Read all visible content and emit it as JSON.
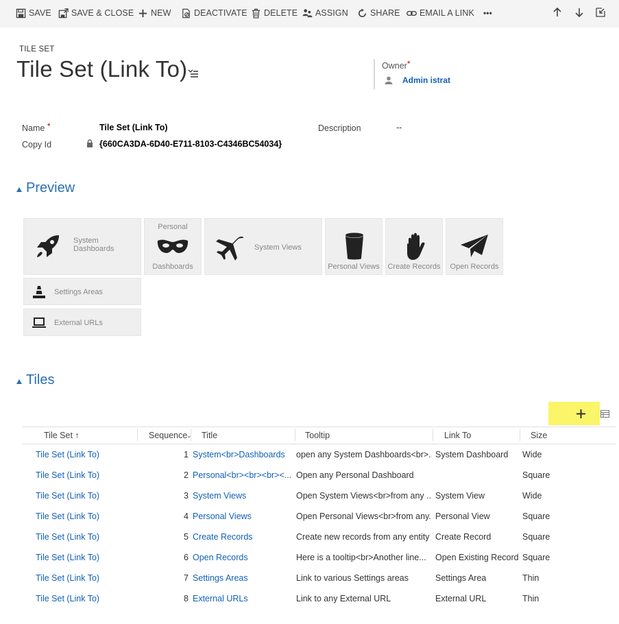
{
  "commandbar": {
    "save": "SAVE",
    "save_close": "SAVE & CLOSE",
    "new": "NEW",
    "deactivate": "DEACTIVATE",
    "delete": "DELETE",
    "assign": "ASSIGN",
    "share": "SHARE",
    "email_link": "EMAIL A LINK",
    "more": "•••"
  },
  "header": {
    "entity": "TILE SET",
    "title": "Tile Set (Link To)",
    "owner_label": "Owner",
    "owner_value": "Admin istrat",
    "required_mark": "*"
  },
  "fields": {
    "name_label": "Name",
    "name_value": "Tile Set (Link To)",
    "copyid_label": "Copy Id",
    "copyid_value": "{660CA3DA-6D40-E711-8103-C4346BC54034}",
    "description_label": "Description",
    "description_value": "--"
  },
  "preview": {
    "heading": "Preview",
    "tiles": {
      "system_dashboards": "System\nDashboards",
      "personal_top": "Personal",
      "personal_bottom": "Dashboards",
      "system_views": "System Views",
      "personal_views": "Personal Views",
      "create_records": "Create Records",
      "open_records": "Open Records",
      "settings_areas": "Settings Areas",
      "external_urls": "External URLs"
    }
  },
  "tiles_section": {
    "heading": "Tiles",
    "columns": [
      "Tile Set ↑",
      "Sequence",
      "Title",
      "Tooltip",
      "Link To",
      "Size"
    ],
    "rows": [
      {
        "tileset": "Tile Set (Link To)",
        "seq": "1",
        "title": "System<br>Dashboards",
        "tooltip": "open any System Dashboards<br>...",
        "linkto": "System Dashboard",
        "size": "Wide"
      },
      {
        "tileset": "Tile Set (Link To)",
        "seq": "2",
        "title": "Personal<br><br><br><...",
        "tooltip": "Open any Personal Dashboard",
        "linkto": "",
        "size": "Square"
      },
      {
        "tileset": "Tile Set (Link To)",
        "seq": "3",
        "title": "System Views",
        "tooltip": "Open System Views<br>from any ...",
        "linkto": "System View",
        "size": "Wide"
      },
      {
        "tileset": "Tile Set (Link To)",
        "seq": "4",
        "title": "Personal Views",
        "tooltip": "Open Personal Views<br>from any...",
        "linkto": "Personal View",
        "size": "Square"
      },
      {
        "tileset": "Tile Set (Link To)",
        "seq": "5",
        "title": "Create Records",
        "tooltip": "Create new records from any entity",
        "linkto": "Create Record",
        "size": "Square"
      },
      {
        "tileset": "Tile Set (Link To)",
        "seq": "6",
        "title": "Open Records",
        "tooltip": "Here is a tooltip<br>Another line...",
        "linkto": "Open Existing Record",
        "size": "Square"
      },
      {
        "tileset": "Tile Set (Link To)",
        "seq": "7",
        "title": "Settings Areas",
        "tooltip": "Link to various Settings areas",
        "linkto": "Settings Area",
        "size": "Thin"
      },
      {
        "tileset": "Tile Set (Link To)",
        "seq": "8",
        "title": "External URLs",
        "tooltip": "Link to any External URL",
        "linkto": "External URL",
        "size": "Thin"
      }
    ]
  },
  "colors": {
    "accent_blue": "#2a6fb5",
    "link_blue": "#1160b7",
    "highlight_yellow": "#fbf569",
    "tile_bg": "#efefef"
  }
}
